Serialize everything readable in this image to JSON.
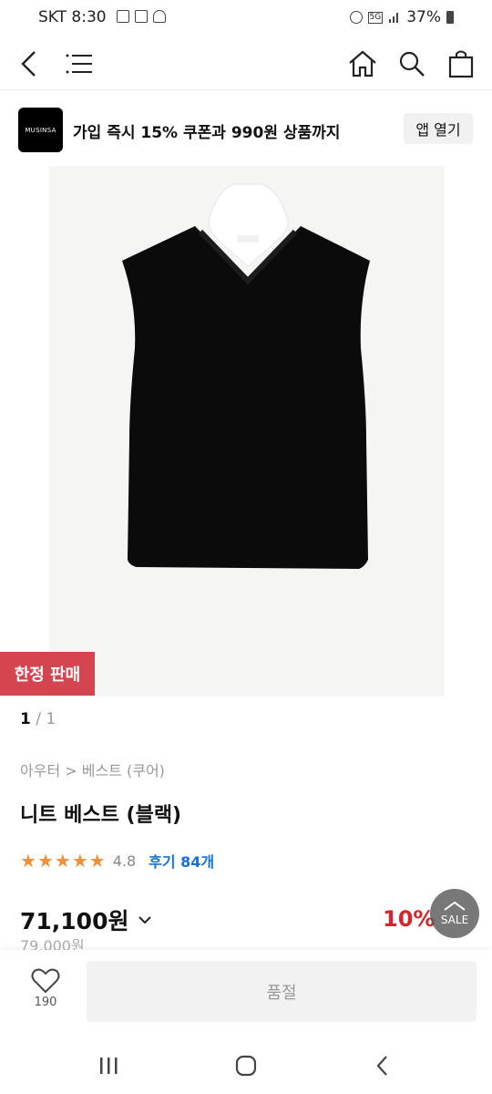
{
  "status_bar": {
    "carrier": "SKT",
    "time": "8:30",
    "network": "5G",
    "battery": "37%"
  },
  "top_nav": {
    "icons": [
      "back-icon",
      "menu-icon",
      "home-icon",
      "search-icon",
      "shopping-bag-icon"
    ]
  },
  "banner": {
    "logo_text": "MUSINSA",
    "promo_text": "가입 즉시 15% 쿠폰과 990원 상품까지",
    "open_app_label": "앱 열기"
  },
  "product": {
    "badge": "한정 판매",
    "pager": {
      "current": "1",
      "separator": "/",
      "total": "1"
    },
    "breadcrumb": "아우터 > 베스트 (쿠어)",
    "name": "니트 베스트 (블랙)",
    "rating": {
      "stars": 5,
      "score": "4.8",
      "reviews_label": "후기 84개"
    },
    "price": "71,100원",
    "original_price": "79,000원",
    "discount": "10%"
  },
  "scroll_top": {
    "label": "SALE"
  },
  "bottom_bar": {
    "like_count": "190",
    "soldout_label": "품절"
  },
  "colors": {
    "badge_bg": "#d5454f",
    "discount": "#d2262d",
    "star": "#f0913a",
    "review_link": "#1a6fd6"
  }
}
